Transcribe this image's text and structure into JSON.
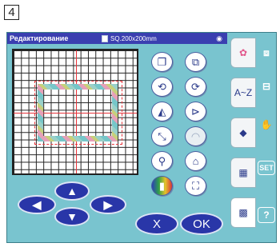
{
  "step_number": "4",
  "title_bar": {
    "title": "Редактирование",
    "size_label": "SQ.200x200mm",
    "signal_icon": "wifi-icon"
  },
  "grid_icons": [
    "copy-icon",
    "duplicate-icon",
    "rotate-left-icon",
    "rotate-right-icon",
    "flip-horizontal-icon",
    "flip-vertical-icon",
    "resize-icon",
    "arc-text-icon",
    "magnify-icon",
    "delete-icon",
    "color-icon",
    "group-icon"
  ],
  "nav_buttons": {
    "up_arrow": "▲",
    "down_arrow": "▼",
    "left_arrow": "◀",
    "right_arrow": "▶"
  },
  "action_buttons": {
    "cancel": "X",
    "ok": "OK"
  },
  "sidebar_tabs": [
    {
      "icon": "pattern-icon",
      "label": ""
    },
    {
      "icon": "az-text-icon",
      "label": "A~Z"
    },
    {
      "icon": "monogram-icon",
      "label": ""
    },
    {
      "icon": "grid-layout-icon",
      "label": ""
    },
    {
      "icon": "edit-grid-icon",
      "label": ""
    }
  ],
  "right_icons": [
    {
      "icon": "embroidery-icon",
      "label": ""
    },
    {
      "icon": "layout-icon",
      "label": ""
    },
    {
      "icon": "hand-icon",
      "label": ""
    },
    {
      "icon": "set-icon",
      "label": "SET"
    },
    {
      "icon": "help-icon",
      "label": "?"
    }
  ]
}
